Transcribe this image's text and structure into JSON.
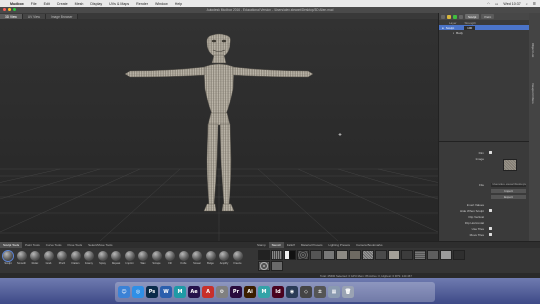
{
  "menubar": {
    "app": "Mudbox",
    "items": [
      "File",
      "Edit",
      "Create",
      "Mesh",
      "Display",
      "UVs & Maps",
      "Render",
      "Window",
      "Help"
    ],
    "clock": "Wed 10:37"
  },
  "window": {
    "title": "Autodesk Mudbox 2016 - Educational Version - /Users/alex.stewart/Desktop/3D Alien.mud"
  },
  "tabs": [
    "3D View",
    "UV View",
    "Image Browser"
  ],
  "right_panel": {
    "tab_buttons": [
      "Sculpt",
      "Paint"
    ],
    "layer_header": {
      "name": "Layer",
      "strength": "Strength"
    },
    "layer_row": {
      "name": "Sculpt",
      "value": "100"
    },
    "object_row": "Body",
    "properties": {
      "dim_label": "Dim",
      "image_label": "Image",
      "file_label": "File",
      "file_value": "/Users/alex.stewart/Desktop/alien.jpg",
      "import_label": "Import",
      "export_label": "Export",
      "invert_values": "Invert Values",
      "hide_when_sculpt": "Hide When Sculpt",
      "flip_vertical": "Flip Vertical",
      "flip_horizontal": "Flip Horizontal",
      "use_tiles": "Use Tiles",
      "move_tiles": "Move Tiles"
    },
    "side_tabs": [
      "Object List",
      "Viewport Filters"
    ]
  },
  "tool_tray": {
    "tabs": [
      "Sculpt Tools",
      "Paint Tools",
      "Curve Tools",
      "Pose Tools",
      "Select/Move Tools"
    ],
    "tools": [
      "Sculpt",
      "Smooth",
      "Relax",
      "Grab",
      "Pinch",
      "Flatten",
      "Foamy",
      "Spray",
      "Repeat",
      "Imprint",
      "Wax",
      "Scrape",
      "Fill",
      "Knife",
      "Smear",
      "Bulge",
      "Amplify",
      "Freeze"
    ]
  },
  "stamp_tray": {
    "tabs": [
      "Stamp",
      "Stencil",
      "Falloff",
      "Material Presets",
      "Lighting Presets",
      "Camera Bookmarks"
    ],
    "active_tab": "Stencil"
  },
  "status": "Total: 25600  Selected: 0  GPU Mem: 86  Active: 0, Highest: 0  FPS: 143.467",
  "dock": {
    "apps": [
      {
        "name": "finder-icon",
        "label": "☺",
        "color": "#3b82d6"
      },
      {
        "name": "safari-icon",
        "label": "◎",
        "color": "#2f8fe6"
      },
      {
        "name": "photoshop-icon",
        "label": "Ps",
        "color": "#0b2b4a"
      },
      {
        "name": "word-icon",
        "label": "W",
        "color": "#2b5fad"
      },
      {
        "name": "maya-icon",
        "label": "M",
        "color": "#1f9aa6"
      },
      {
        "name": "after-effects-icon",
        "label": "Ae",
        "color": "#25124a"
      },
      {
        "name": "autocad-icon",
        "label": "A",
        "color": "#c7302b"
      },
      {
        "name": "system-prefs-icon",
        "label": "⚙",
        "color": "#808080"
      },
      {
        "name": "premiere-icon",
        "label": "Pr",
        "color": "#2a0c3d"
      },
      {
        "name": "illustrator-icon",
        "label": "Ai",
        "color": "#3a1e00"
      },
      {
        "name": "mudbox-icon",
        "label": "M",
        "color": "#34a3a8"
      },
      {
        "name": "indesign-icon",
        "label": "Id",
        "color": "#49021f"
      },
      {
        "name": "steam-icon",
        "label": "◉",
        "color": "#2a3b57"
      },
      {
        "name": "unity-icon",
        "label": "◇",
        "color": "#444444"
      },
      {
        "name": "calculator-icon",
        "label": "±",
        "color": "#555555"
      },
      {
        "name": "preview-icon",
        "label": "▦",
        "color": "#8a9ab0"
      },
      {
        "name": "trash-icon",
        "label": "🗑",
        "color": "#9aa3b3"
      }
    ]
  }
}
